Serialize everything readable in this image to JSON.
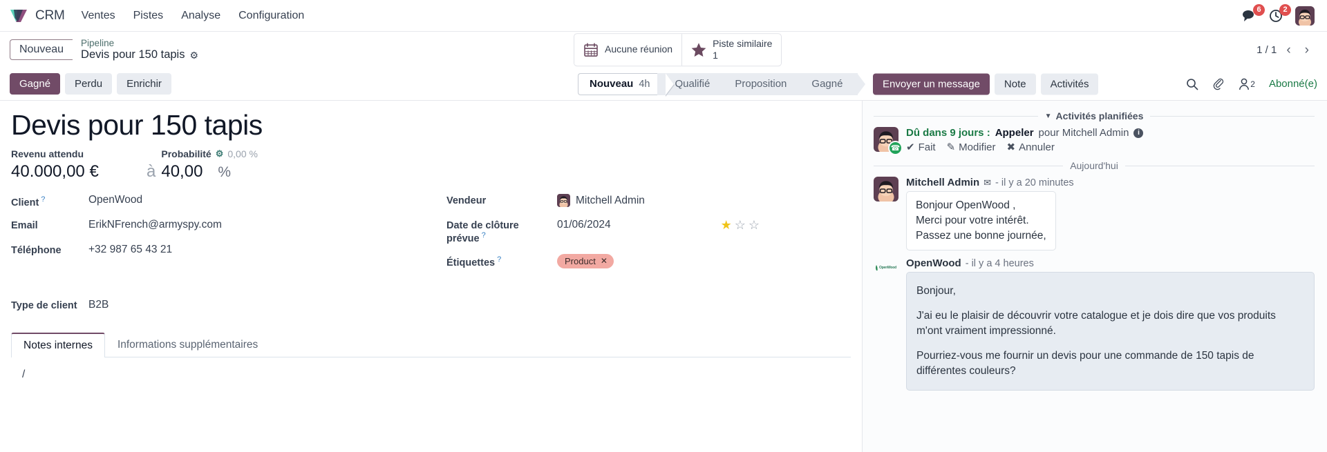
{
  "navbar": {
    "brand": "CRM",
    "logo_icon": "odoo-diamond-logo",
    "menus": [
      {
        "label": "Ventes"
      },
      {
        "label": "Pistes"
      },
      {
        "label": "Analyse"
      },
      {
        "label": "Configuration"
      }
    ],
    "messages_icon": "chat-bubble-icon",
    "messages_count": "6",
    "activities_icon": "clock-icon",
    "activities_count": "2",
    "user_avatar": "user-avatar"
  },
  "control_bar": {
    "status_pill": "Nouveau",
    "breadcrumb_parent": "Pipeline",
    "breadcrumb_current": "Devis pour 150 tapis",
    "settings_icon": "gear-icon",
    "stat_buttons": [
      {
        "icon": "calendar-icon",
        "label": "Aucune réunion",
        "sub": ""
      },
      {
        "icon": "star-icon",
        "label": "Piste similaire",
        "sub": "1"
      }
    ],
    "pager": "1 / 1",
    "prev_icon": "chevron-left-icon",
    "next_icon": "chevron-right-icon"
  },
  "action_row": {
    "buttons": [
      {
        "label": "Gagné",
        "style": "primary"
      },
      {
        "label": "Perdu",
        "style": "secondary"
      },
      {
        "label": "Enrichir",
        "style": "secondary"
      }
    ],
    "stages": [
      {
        "label": "Nouveau",
        "duration": "4h",
        "active": true
      },
      {
        "label": "Qualifié",
        "duration": "",
        "active": false
      },
      {
        "label": "Proposition",
        "duration": "",
        "active": false
      },
      {
        "label": "Gagné",
        "duration": "",
        "active": false
      }
    ],
    "chatter_buttons": [
      {
        "label": "Envoyer un message",
        "style": "primary"
      },
      {
        "label": "Note",
        "style": "secondary"
      },
      {
        "label": "Activités",
        "style": "secondary"
      }
    ],
    "tools": [
      {
        "icon": "search-icon"
      },
      {
        "icon": "paperclip-icon"
      },
      {
        "icon": "follower-person-icon",
        "count": "2"
      }
    ],
    "subscribed_label": "Abonné(e)"
  },
  "record": {
    "title": "Devis pour 150 tapis",
    "expected_revenue_label": "Revenu attendu",
    "expected_revenue_value": "40.000,00 €",
    "probability_label": "Probabilité",
    "probability_gear_icon": "gear-icon",
    "probability_hint": "0,00 %",
    "probability_separator": "à",
    "probability_value": "40,00",
    "probability_unit": "%",
    "fields_left": [
      {
        "label": "Client",
        "help": "?",
        "value": "OpenWood"
      },
      {
        "label": "Email",
        "help": "",
        "value": "ErikNFrench@armyspy.com"
      },
      {
        "label": "Téléphone",
        "help": "",
        "value": "+32 987 65 43 21"
      },
      {
        "label": "",
        "help": "",
        "value": ""
      },
      {
        "label": "Type de client",
        "help": "",
        "value": "B2B"
      }
    ],
    "fields_right": [
      {
        "label": "Vendeur",
        "help": "",
        "value": "Mitchell Admin",
        "avatar": true
      },
      {
        "label": "Date de clôture prévue",
        "help": "?",
        "value": "01/06/2024",
        "stars": 1
      },
      {
        "label": "Étiquettes",
        "help": "?",
        "value": "",
        "tag": "Product",
        "tag_remove_icon": "close-icon"
      }
    ],
    "stars_total": 3,
    "tabs": [
      {
        "label": "Notes internes",
        "active": true
      },
      {
        "label": "Informations supplémentaires",
        "active": false
      }
    ],
    "notes_content": "/"
  },
  "chatter": {
    "planned_section_label": "Activités planifiées",
    "planned_caret_icon": "caret-down-icon",
    "activity": {
      "avatar": "user-avatar",
      "status_icon": "phone-icon",
      "due_text": "Dû dans 9 jours :",
      "type": "Appeler",
      "assignee": "pour Mitchell Admin",
      "info_icon": "info-icon",
      "actions": [
        {
          "icon": "check-icon",
          "label": "Fait"
        },
        {
          "icon": "pencil-icon",
          "label": "Modifier"
        },
        {
          "icon": "cross-icon",
          "label": "Annuler"
        }
      ]
    },
    "day_divider": "Aujourd'hui",
    "messages": [
      {
        "author": "Mitchell Admin",
        "channel_icon": "envelope-icon",
        "timestamp": "- il y a 20 minutes",
        "avatar_type": "user",
        "body_lines": [
          "Bonjour OpenWood ,",
          "Merci pour votre intérêt.",
          "Passez une bonne journée,"
        ],
        "style": "internal"
      },
      {
        "author": "OpenWood",
        "channel_icon": "",
        "timestamp": "- il y a 4 heures",
        "avatar_type": "openwood-logo",
        "body_lines": [
          "Bonjour,",
          "J'ai eu le plaisir de découvrir votre catalogue et je dois dire que vos produits m'ont vraiment impressionné.",
          "Pourriez-vous me fournir un devis pour une commande de 150 tapis de différentes couleurs?"
        ],
        "style": "customer"
      }
    ]
  },
  "colors": {
    "primary": "#714b67",
    "secondary_bg": "#e9ecf1",
    "link_teal": "#4c6e6b",
    "success_green": "#1a7a45",
    "badge_red": "#e04f4f",
    "tag_pink": "#f2a9a2",
    "star_gold": "#f0c419"
  }
}
